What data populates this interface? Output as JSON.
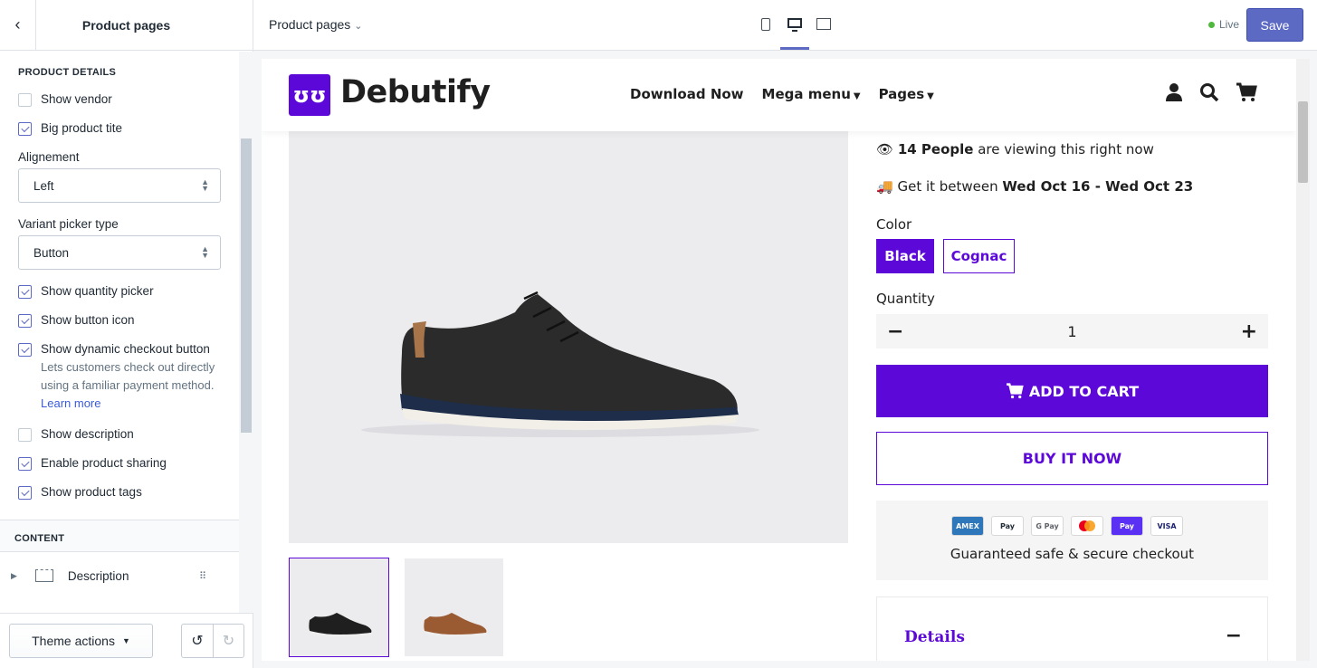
{
  "sidebar": {
    "title": "Product pages",
    "section_title": "PRODUCT DETAILS",
    "items": {
      "show_vendor": "Show vendor",
      "big_title": "Big product tite",
      "alignment_label": "Alignement",
      "alignment_value": "Left",
      "variant_label": "Variant picker type",
      "variant_value": "Button",
      "qty_picker": "Show quantity picker",
      "button_icon": "Show button icon",
      "dynamic_checkout": "Show dynamic checkout button",
      "dynamic_help": "Lets customers check out directly using a familiar payment method.",
      "learn_more": "Learn more",
      "show_description": "Show description",
      "sharing": "Enable product sharing",
      "tags": "Show product tags"
    },
    "content_title": "CONTENT",
    "description_block": "Description",
    "footer": {
      "theme_actions": "Theme actions"
    }
  },
  "topbar": {
    "page_select": "Product pages",
    "live": "Live",
    "save": "Save"
  },
  "store": {
    "logo_mark": "ʊʊ",
    "logo_text": "Debutify",
    "nav": [
      "Download Now",
      "Mega menu",
      "Pages"
    ],
    "viewing_count": "14 People",
    "viewing_rest": " are viewing this right now",
    "shipping_prefix": "Get it between ",
    "shipping_dates": "Wed Oct 16 - Wed Oct 23",
    "color_label": "Color",
    "colors": [
      "Black",
      "Cognac"
    ],
    "quantity_label": "Quantity",
    "quantity": "1",
    "add_to_cart": "ADD TO CART",
    "buy_now": "BUY IT NOW",
    "payment_icons": [
      "AMEX",
      "Pay",
      "G Pay",
      "MC",
      "Pay",
      "VISA"
    ],
    "secure_text": "Guaranteed safe & secure checkout",
    "details_title": "Details"
  },
  "colors": {
    "accent": "#5b08d9",
    "shopify_primary": "#5c6ac4"
  }
}
